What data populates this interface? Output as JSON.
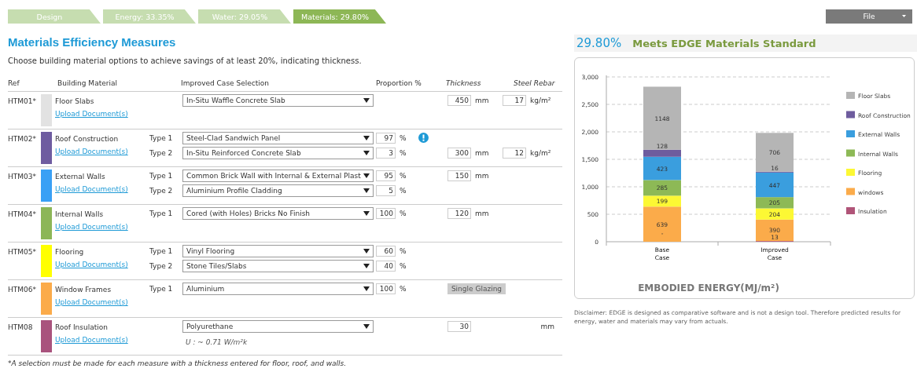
{
  "tabs": [
    {
      "label": "Design",
      "selected": false
    },
    {
      "label": "Energy: 33.35%",
      "selected": false
    },
    {
      "label": "Water: 29.05%",
      "selected": false
    },
    {
      "label": "Materials: 29.80%",
      "selected": true
    }
  ],
  "file_menu": {
    "label": "File"
  },
  "title": "Materials Efficiency Measures",
  "subtitle": "Choose building material options to achieve savings of at least 20%, indicating thickness.",
  "columns": [
    "Ref",
    "Building Material",
    "Improved Case Selection",
    "Proportion %",
    "Thickness",
    "Steel Rebar"
  ],
  "rows": [
    {
      "ref": "HTM01*",
      "material": "Floor Slabs",
      "color": "#e2e2e2",
      "link": "Upload Document(s)",
      "lines": [
        {
          "selection": "In-Situ Waffle Concrete Slab",
          "thickness": "450",
          "thickness_unit": "mm",
          "rebar": "17",
          "rebar_unit": "kg/m²"
        }
      ]
    },
    {
      "ref": "HTM02*",
      "material": "Roof Construction",
      "color": "#6e5ca0",
      "link": "Upload Document(s)",
      "lines": [
        {
          "type": "Type 1",
          "selection": "Steel-Clad Sandwich Panel",
          "proportion": "97",
          "unit": "%",
          "alert": true
        },
        {
          "type": "Type 2",
          "selection": "In-Situ Reinforced Concrete Slab",
          "proportion": "3",
          "unit": "%",
          "thickness": "300",
          "thickness_unit": "mm",
          "rebar": "12",
          "rebar_unit": "kg/m²"
        }
      ]
    },
    {
      "ref": "HTM03*",
      "material": "External Walls",
      "color": "#3aa0f5",
      "link": "Upload Document(s)",
      "lines": [
        {
          "type": "Type 1",
          "selection": "Common Brick Wall with Internal & External Plast",
          "proportion": "95",
          "unit": "%",
          "thickness": "150",
          "thickness_unit": "mm"
        },
        {
          "type": "Type 2",
          "selection": "Aluminium Profile Cladding",
          "proportion": "5",
          "unit": "%"
        }
      ]
    },
    {
      "ref": "HTM04*",
      "material": "Internal Walls",
      "color": "#8cb657",
      "link": "Upload Document(s)",
      "lines": [
        {
          "type": "Type 1",
          "selection": "Cored (with Holes) Bricks No Finish",
          "proportion": "100",
          "unit": "%",
          "thickness": "120",
          "thickness_unit": "mm"
        }
      ]
    },
    {
      "ref": "HTM05*",
      "material": "Flooring",
      "color": "#ffff00",
      "link": "Upload Document(s)",
      "lines": [
        {
          "type": "Type 1",
          "selection": "Vinyl Flooring",
          "proportion": "60",
          "unit": "%"
        },
        {
          "type": "Type 2",
          "selection": "Stone Tiles/Slabs",
          "proportion": "40",
          "unit": "%"
        }
      ]
    },
    {
      "ref": "HTM06*",
      "material": "Window Frames",
      "color": "#fbab4a",
      "link": "Upload Document(s)",
      "lines": [
        {
          "type": "Type 1",
          "selection": "Aluminium",
          "proportion": "100",
          "unit": "%",
          "glazing": "Single Glazing"
        }
      ]
    },
    {
      "ref": "HTM08",
      "material": "Roof Insulation",
      "color": "#a9537d",
      "link": "Upload Document(s)",
      "lines": [
        {
          "selection": "Polyurethane",
          "thickness": "30",
          "rebar_unit": "mm"
        }
      ],
      "note": "U : ~ 0.71 W/m²k"
    }
  ],
  "footnote": "*A selection must be made for each measure with a thickness entered for floor, roof, and walls.",
  "result": {
    "value": "29.80%",
    "status": "Meets EDGE Materials Standard"
  },
  "chart": {
    "chart_data": {
      "type": "bar",
      "stacked": true,
      "grid": true,
      "legend": "right",
      "title": "EMBODIED ENERGY(MJ/m²)",
      "categories": [
        "Base Case",
        "Improved Case"
      ],
      "ylim": [
        0,
        3000
      ],
      "yticks": [
        {
          "value": 0,
          "label": "0"
        },
        {
          "value": 500,
          "label": "500"
        },
        {
          "value": 1000,
          "label": "1,000"
        },
        {
          "value": 1500,
          "label": "1,500"
        },
        {
          "value": 2000,
          "label": "2,000"
        },
        {
          "value": 2500,
          "label": "2,500"
        },
        {
          "value": 3000,
          "label": "3,000"
        }
      ],
      "series": [
        {
          "name": "Insulation",
          "color": "#b05478",
          "values": [
            0,
            13
          ]
        },
        {
          "name": "windows",
          "color": "#fbab4a",
          "values": [
            639,
            390
          ]
        },
        {
          "name": "Flooring",
          "color": "#fcf834",
          "values": [
            199,
            204
          ]
        },
        {
          "name": "Internal Walls",
          "color": "#8db956",
          "values": [
            285,
            205
          ]
        },
        {
          "name": "External Walls",
          "color": "#3a9ede",
          "values": [
            423,
            447
          ]
        },
        {
          "name": "Roof Construction",
          "color": "#6e5c9e",
          "values": [
            128,
            16
          ]
        },
        {
          "name": "Floor Slabs",
          "color": "#b5b5b5",
          "values": [
            1148,
            706
          ]
        }
      ],
      "value_labels": [
        [
          "-",
          "13"
        ],
        [
          "639",
          "390"
        ],
        [
          "199",
          "204"
        ],
        [
          "285",
          "205"
        ],
        [
          "423",
          "447"
        ],
        [
          "128",
          "16"
        ],
        [
          "1148",
          "706"
        ]
      ]
    }
  },
  "disclaimer": "Disclaimer: EDGE is designed as comparative software and is not a design tool. Therefore predicted results for energy, water and materials may vary from actuals."
}
